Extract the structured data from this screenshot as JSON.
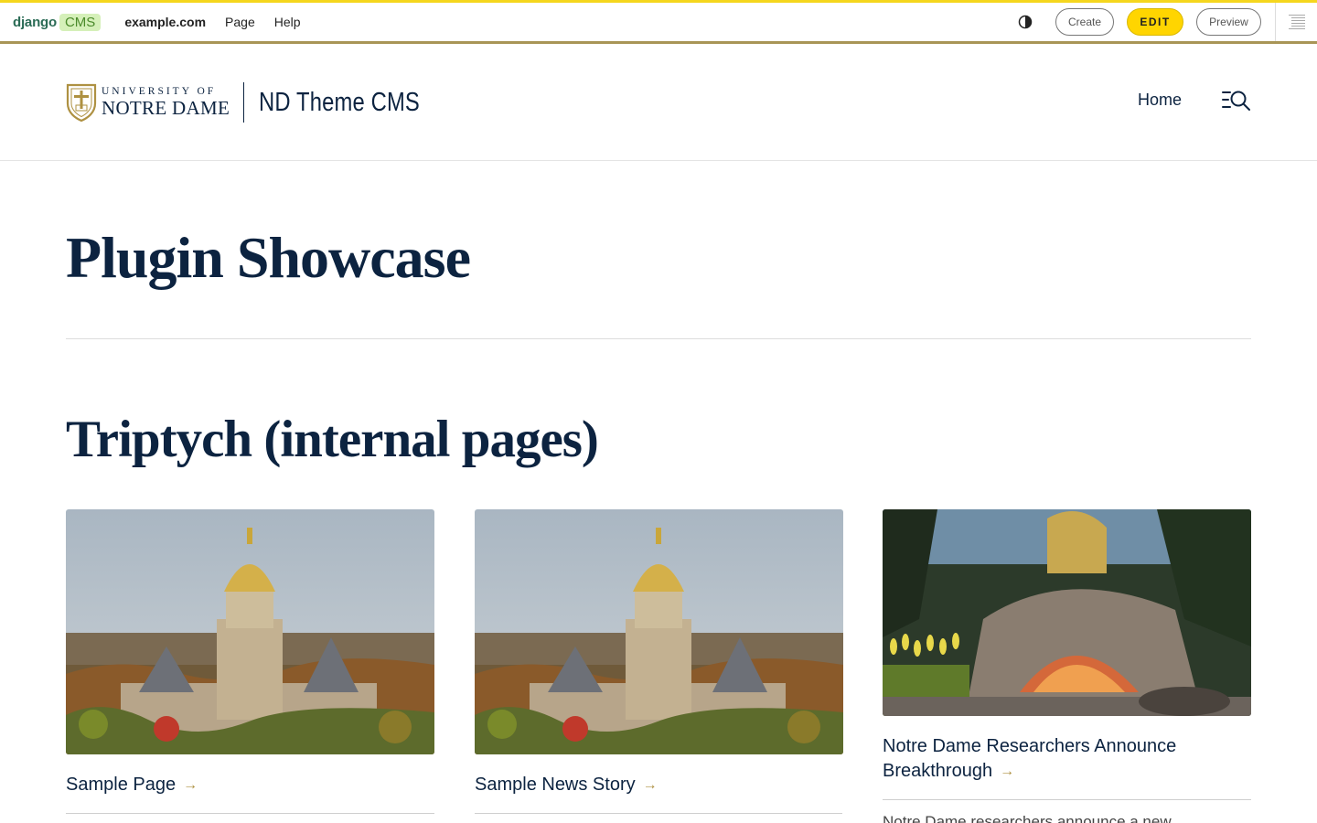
{
  "toolbar": {
    "logo_django": "django",
    "logo_cms": "CMS",
    "menu": [
      {
        "label": "example.com"
      },
      {
        "label": "Page"
      },
      {
        "label": "Help"
      }
    ],
    "create_label": "Create",
    "edit_label": "EDIT",
    "preview_label": "Preview",
    "icons": [
      "contrast-toggle-icon",
      "structure-mode-icon"
    ],
    "accent_color": "#ffd500"
  },
  "header": {
    "logo": {
      "line1": "UNIVERSITY OF",
      "line2": "NOTRE DAME",
      "icon": "notre-dame-shield"
    },
    "site_name": "ND Theme CMS",
    "nav_home": "Home",
    "menu_icon": "menu-search-icon"
  },
  "main": {
    "page_title": "Plugin Showcase",
    "section_title": "Triptych (internal pages)",
    "cards": [
      {
        "image": "golden-dome-aerial-photo",
        "link_text": "Sample Page"
      },
      {
        "image": "golden-dome-aerial-photo",
        "link_text": "Sample News Story"
      },
      {
        "image": "grotto-photo",
        "link_text_line1": "Notre Dame Researchers Announce",
        "link_text_line2": "Breakthrough",
        "description": "Notre Dame researchers announce a new"
      }
    ],
    "arrow_glyph": "→"
  },
  "colors": {
    "navy": "#0c2340",
    "gold": "#ae9142"
  }
}
